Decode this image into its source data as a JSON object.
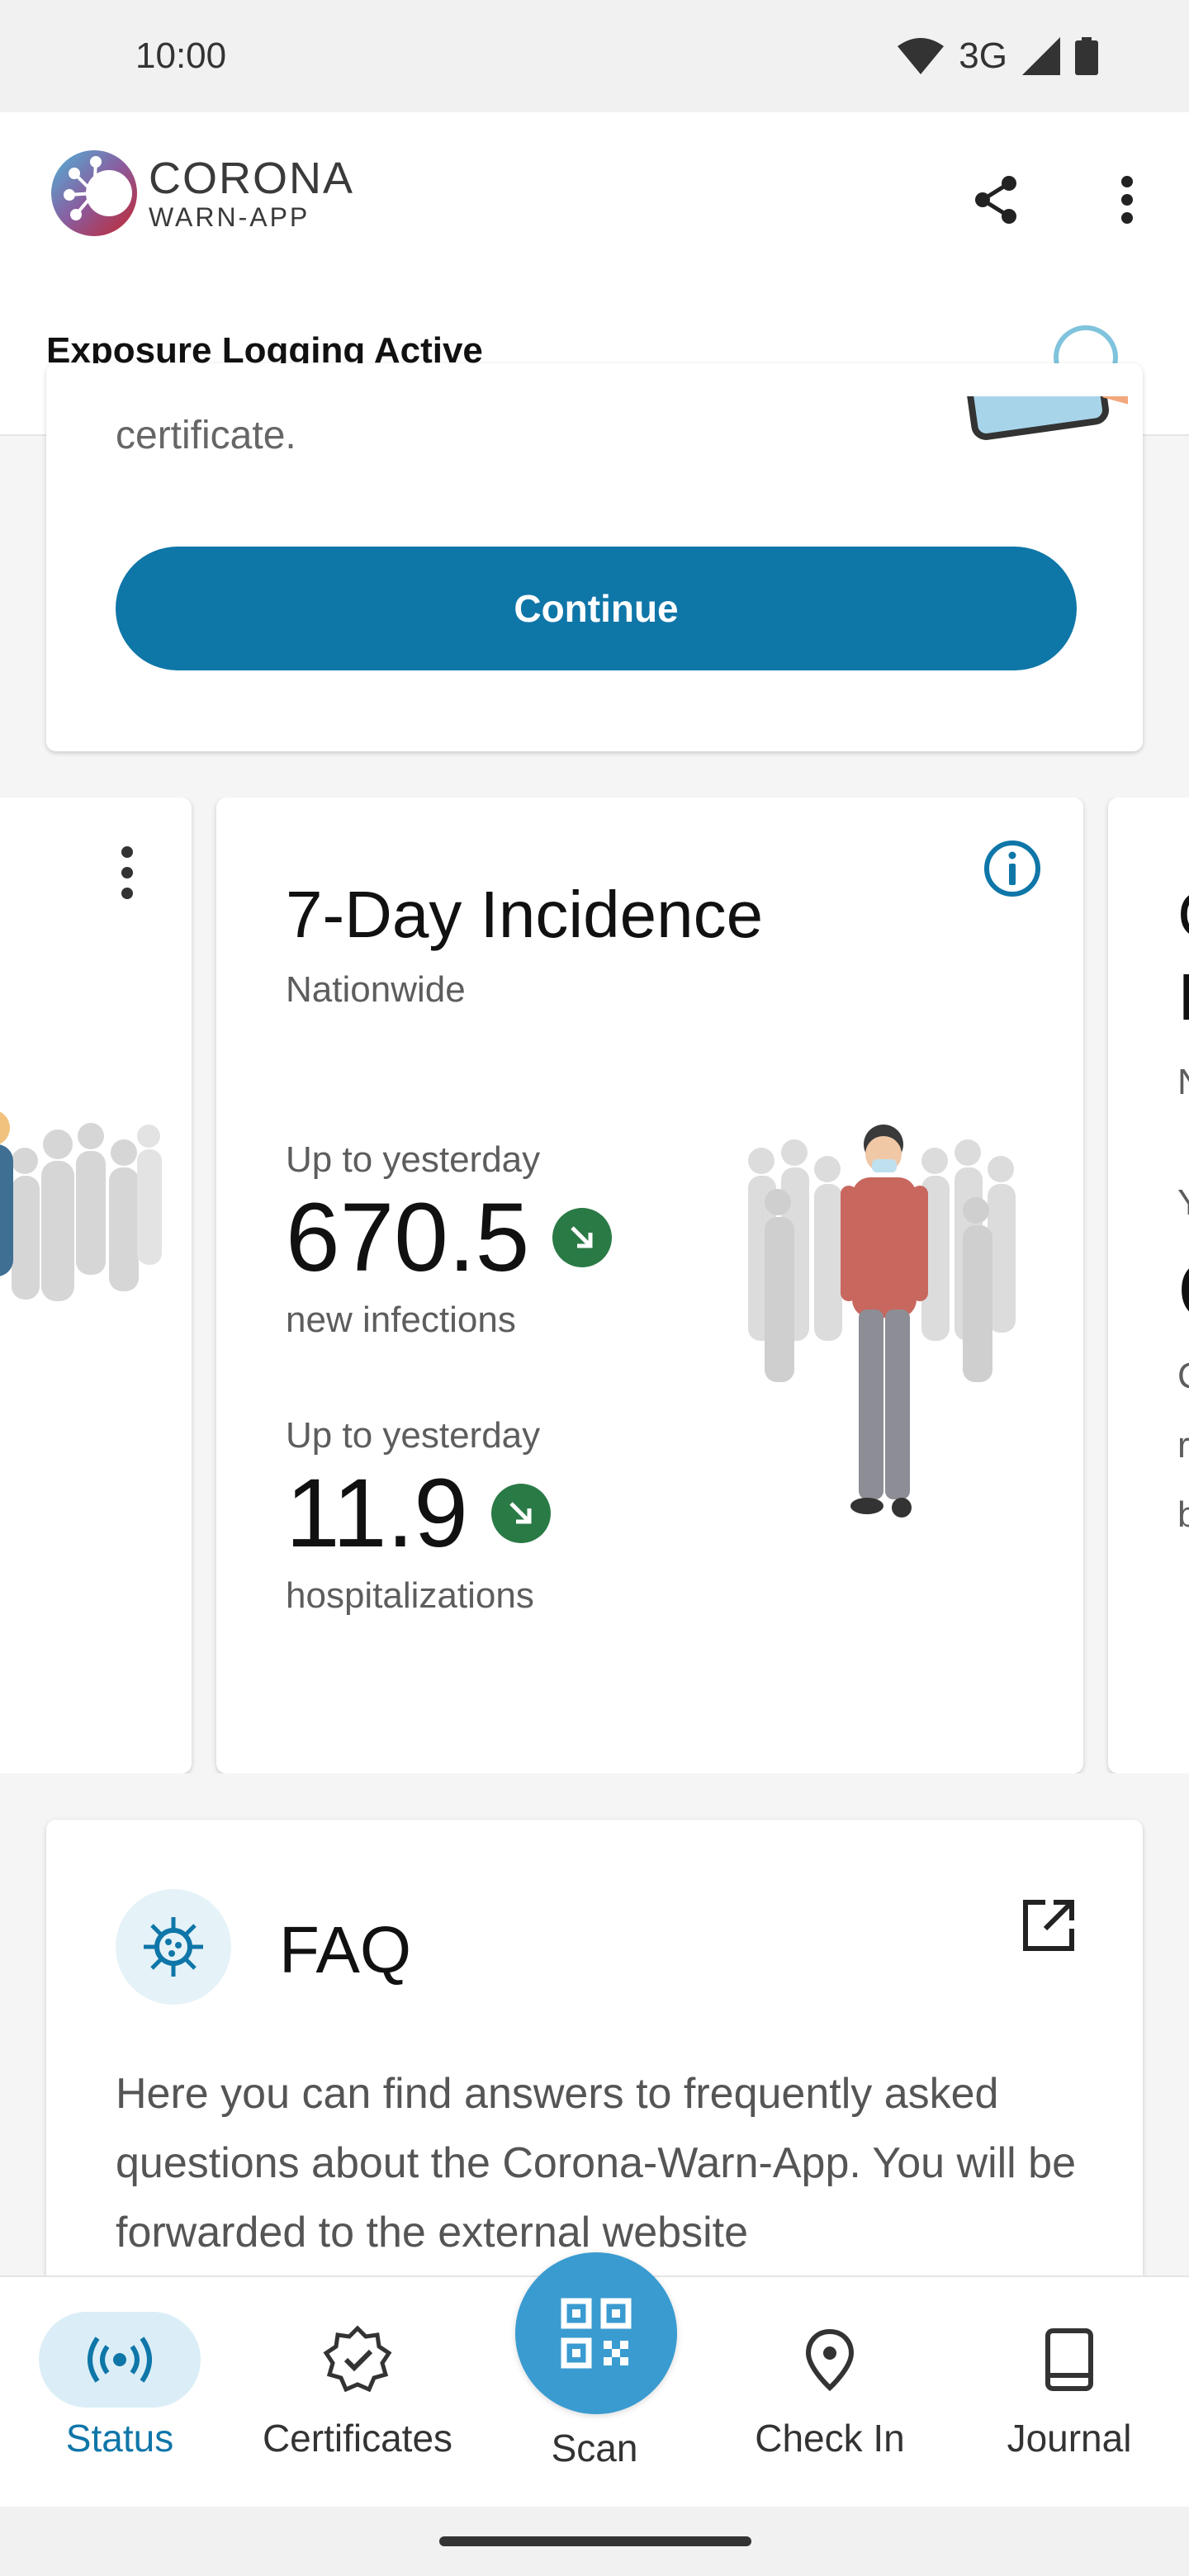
{
  "status_bar": {
    "time": "10:00",
    "network": "3G"
  },
  "header": {
    "logo_line1": "CORONA",
    "logo_line2": "WARN-APP",
    "exposure_status": "Exposure Logging Active"
  },
  "top_card": {
    "partial_text": "certificate.",
    "continue_label": "Continue"
  },
  "incidence_card": {
    "title": "7-Day Incidence",
    "subtitle": "Nationwide",
    "stats": [
      {
        "label": "Up to yesterday",
        "value": "670.5",
        "desc": "new infections",
        "trend": "down"
      },
      {
        "label": "Up to yesterday",
        "value": "11.9",
        "desc": "hospitalizations",
        "trend": "down"
      }
    ]
  },
  "right_card_fragments": [
    "C",
    "I",
    "N",
    "Y",
    "C",
    "C",
    "r",
    "b"
  ],
  "faq": {
    "title": "FAQ",
    "text": "Here you can find answers to frequently asked questions about the Corona-Warn-App. You will be forwarded to the external website"
  },
  "bottom_nav": {
    "status": "Status",
    "certificates": "Certificates",
    "scan": "Scan",
    "checkin": "Check In",
    "journal": "Journal"
  },
  "colors": {
    "primary": "#0f76a8",
    "scan": "#3a9bd1",
    "trend_down": "#2a7a46"
  }
}
